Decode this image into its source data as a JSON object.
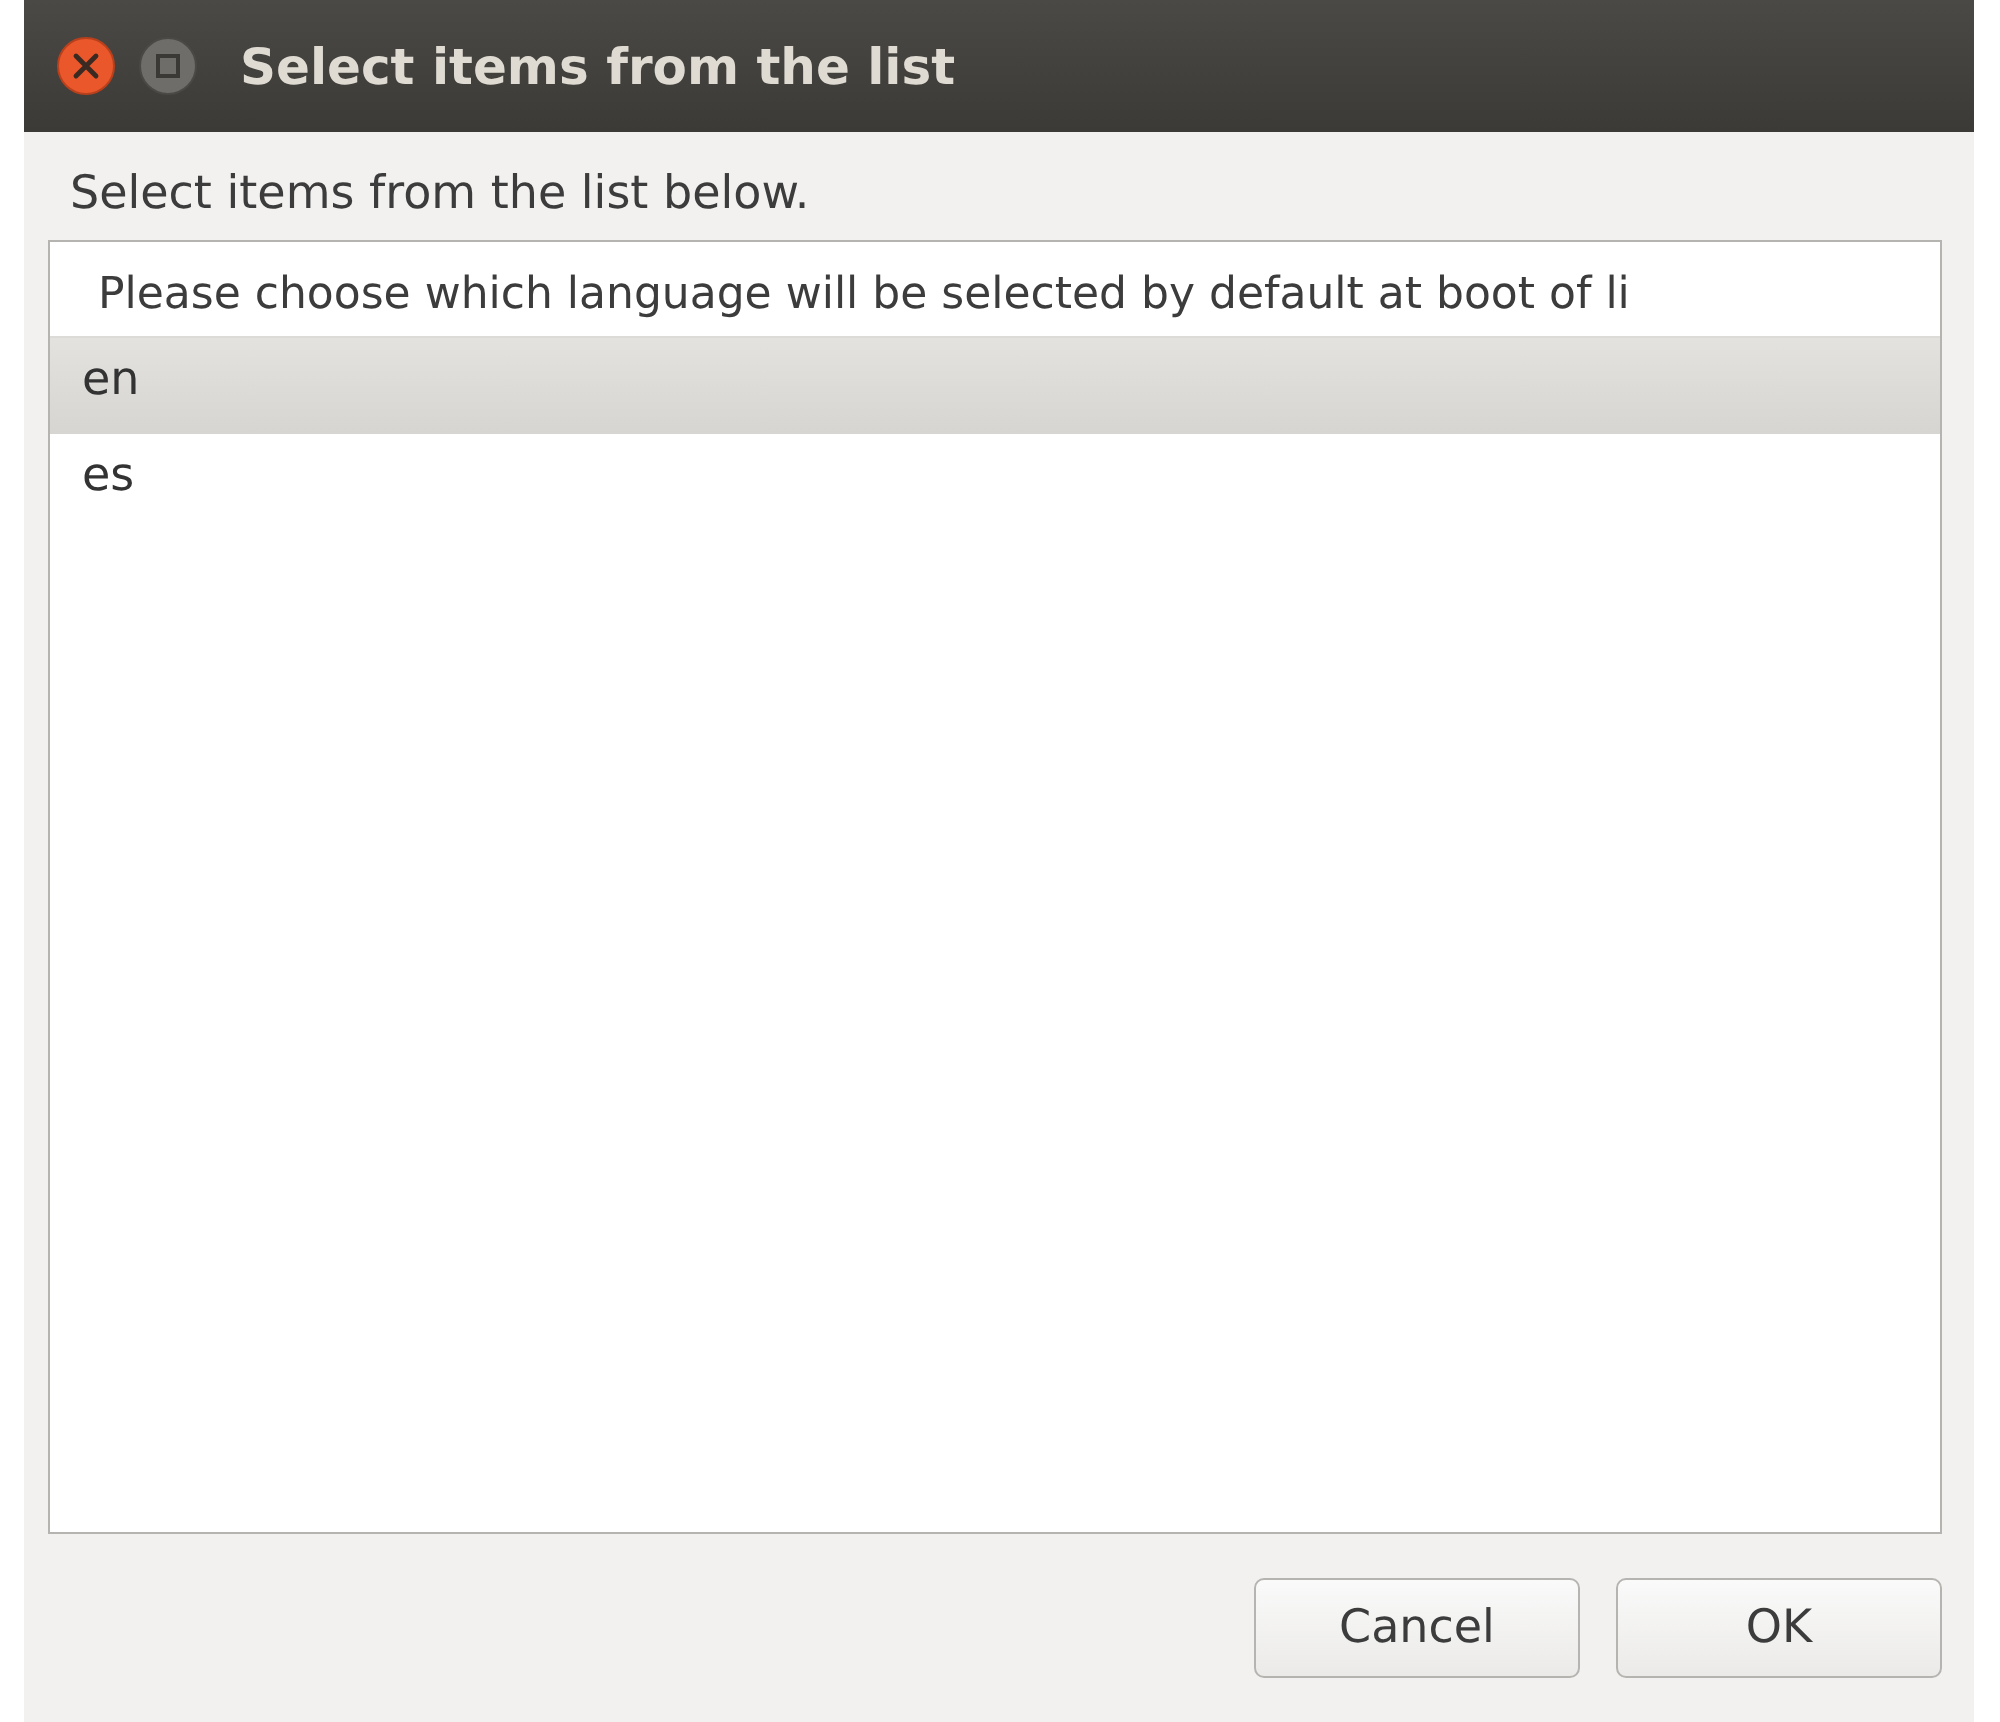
{
  "window": {
    "title": "Select items from the list"
  },
  "instruction": "Select items from the list below.",
  "list": {
    "header": "Please choose which language will be selected by default at boot of li",
    "rows": [
      {
        "label": "en",
        "selected": true
      },
      {
        "label": "es",
        "selected": false
      }
    ]
  },
  "buttons": [
    "Cancel",
    "OK"
  ]
}
